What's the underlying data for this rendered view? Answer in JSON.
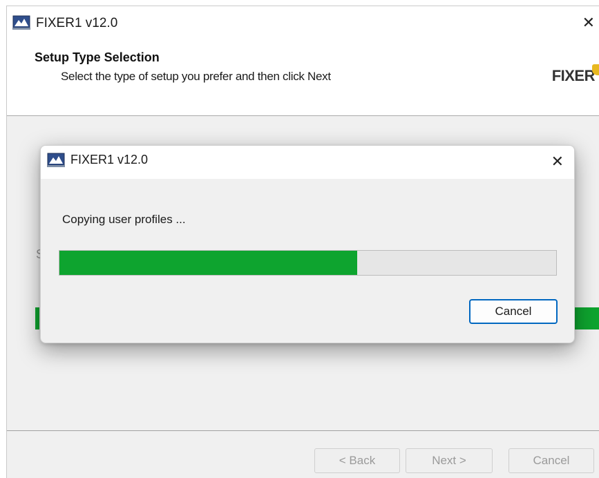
{
  "main_window": {
    "title": "FIXER1 v12.0",
    "header": {
      "title": "Setup Type Selection",
      "subtitle": "Select the type of setup you prefer and then click Next",
      "logo_text": "FIXER"
    },
    "buttons": {
      "back": "< Back",
      "next": "Next >",
      "cancel": "Cancel"
    }
  },
  "dialog": {
    "title": "FIXER1 v12.0",
    "status": "Copying user profiles ...",
    "progress_percent": 60,
    "cancel_label": "Cancel"
  },
  "colors": {
    "progress_fill": "#0ea42f",
    "focus_border": "#0067c0",
    "logo_accent": "#e8b820"
  },
  "icons": {
    "app_icon": "installer-app-icon",
    "close_icon": "close-icon"
  }
}
